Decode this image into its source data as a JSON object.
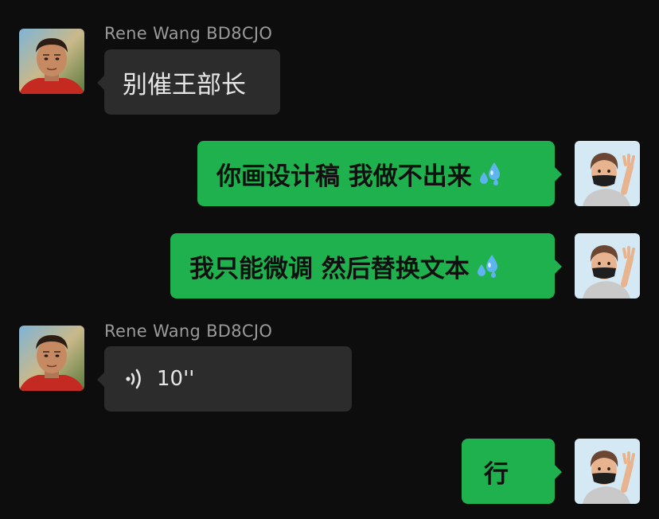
{
  "contact": {
    "name": "Rene Wang BD8CJO",
    "avatar_icon": "man-portrait-avatar"
  },
  "me": {
    "avatar_icon": "memoji-masked-avatar"
  },
  "colors": {
    "background": "#0d0d0d",
    "incoming_bubble": "#2c2c2c",
    "outgoing_bubble": "#20b14f",
    "name_text": "#9a9a9a"
  },
  "messages": [
    {
      "direction": "incoming",
      "sender": "Rene Wang BD8CJO",
      "text": "别催王部长"
    },
    {
      "direction": "outgoing",
      "text": "你画设计稿 我做不出来",
      "emoji": "sweat-droplets-icon"
    },
    {
      "direction": "outgoing",
      "text": "我只能微调 然后替换文本",
      "emoji": "sweat-droplets-icon"
    },
    {
      "direction": "incoming",
      "sender": "Rene Wang BD8CJO",
      "type": "voice",
      "duration": "10''",
      "icon": "voice-wave-icon"
    },
    {
      "direction": "outgoing",
      "text": "行"
    }
  ]
}
